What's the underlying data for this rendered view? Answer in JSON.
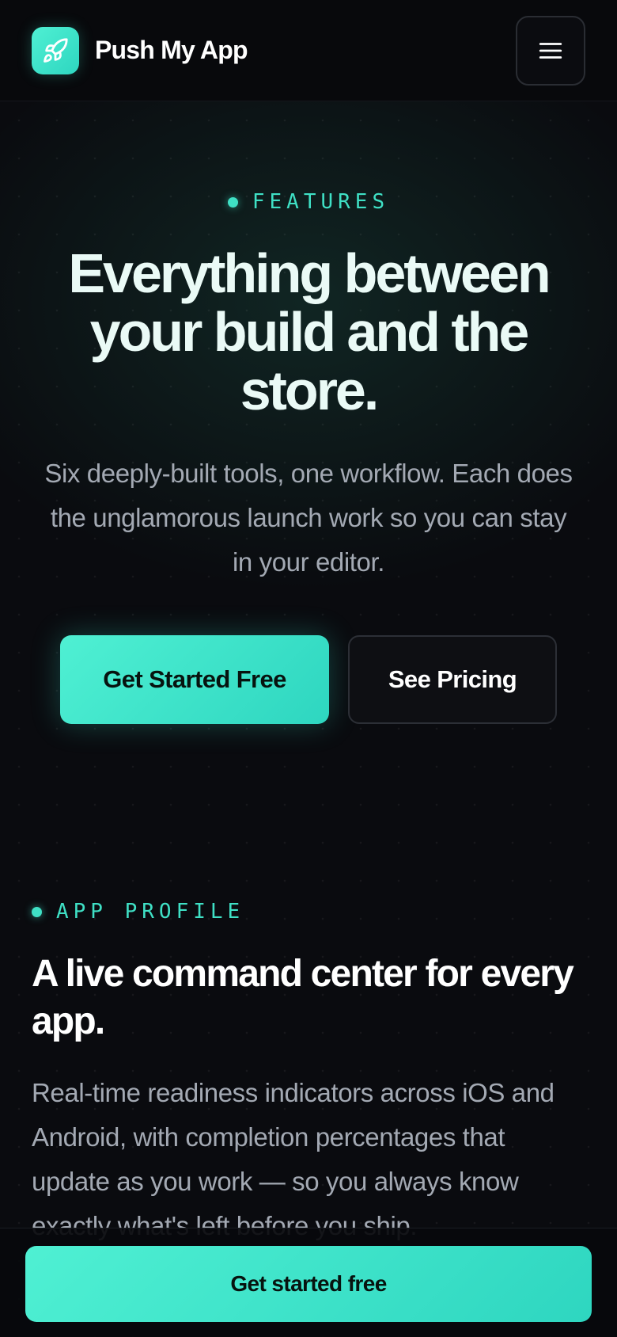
{
  "header": {
    "brand": "Push My App",
    "logo_icon": "rocket-icon",
    "menu_icon": "hamburger-menu-icon"
  },
  "hero": {
    "eyebrow": "FEATURES",
    "title": "Everything between your build and the store.",
    "subtitle": "Six deeply-built tools, one workflow. Each does the unglamorous launch work so you can stay in your editor.",
    "primary_cta": "Get Started Free",
    "secondary_cta": "See Pricing"
  },
  "app_profile": {
    "eyebrow": "APP PROFILE",
    "title": "A live command center for every app.",
    "body": "Real-time readiness indicators across iOS and Android, with completion percentages that update as you work — so you always know exactly what's left before you ship."
  },
  "sticky": {
    "cta": "Get started free"
  },
  "colors": {
    "accent": "#3fe0c5",
    "background": "#0a0b0f",
    "muted_text": "#a3a9b3"
  }
}
